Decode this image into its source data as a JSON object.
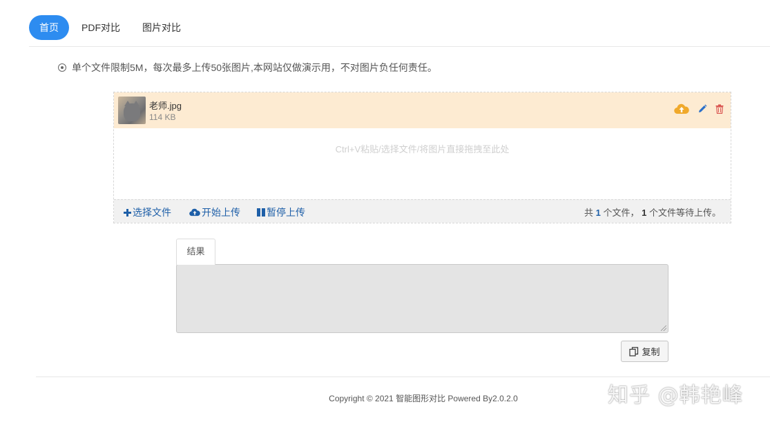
{
  "nav": {
    "tabs": [
      {
        "label": "首页",
        "active": true
      },
      {
        "label": "PDF对比",
        "active": false
      },
      {
        "label": "图片对比",
        "active": false
      }
    ]
  },
  "notice": {
    "icon": "radio-dot-icon",
    "text": "单个文件限制5M，每次最多上传50张图片,本网站仅做演示用，不对图片负任何责任。"
  },
  "uploader": {
    "file": {
      "name": "老师.jpg",
      "size": "114 KB",
      "actions": [
        "cloud-upload-icon",
        "pencil-icon",
        "trash-icon"
      ]
    },
    "drop_hint": "Ctrl+V粘贴/选择文件/将图片直接拖拽至此处",
    "toolbar": {
      "select_label": "选择文件",
      "start_label": "开始上传",
      "pause_label": "暂停上传",
      "status_prefix": "共",
      "total_count": "1",
      "status_mid": "个文件，",
      "pending_count": "1",
      "status_suffix": "个文件等待上传。"
    }
  },
  "result": {
    "tab_label": "结果",
    "content": "",
    "copy_label": "复制"
  },
  "footer": {
    "text": "Copyright © 2021 智能图形对比 Powered By2.0.2.0"
  },
  "watermark": {
    "text": "知乎 @韩艳峰"
  },
  "colors": {
    "accent": "#2d8cf0",
    "file_row_bg": "#fdebd2",
    "upload_icon": "#f0a92b",
    "edit_icon": "#2a6fc9",
    "delete_icon": "#d9534f",
    "toolbar_link": "#1e5fa8"
  }
}
